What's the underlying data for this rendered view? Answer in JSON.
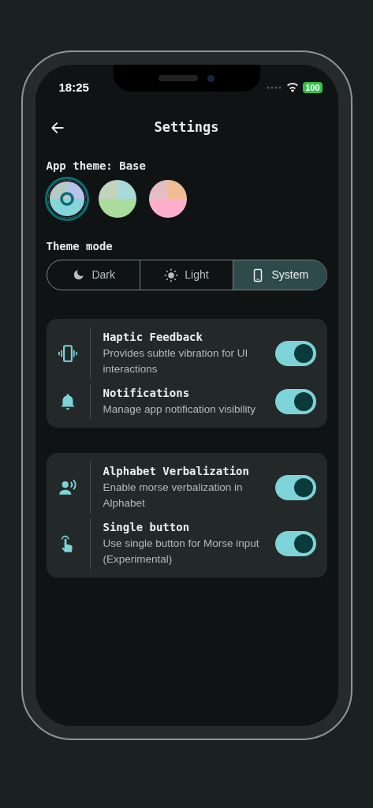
{
  "status_bar": {
    "time": "18:25",
    "battery": "100"
  },
  "header": {
    "title": "Settings"
  },
  "app_theme": {
    "label": "App theme: Base",
    "swatches": [
      {
        "selected": true,
        "parts": [
          {
            "color": "#b7c9c6"
          },
          {
            "color": "#b6c3ea"
          },
          {
            "color": "#86d6d9"
          }
        ]
      },
      {
        "selected": false,
        "parts": [
          {
            "color": "#c2d4bd"
          },
          {
            "color": "#a9d9d8"
          },
          {
            "color": "#a9dc9e"
          }
        ]
      },
      {
        "selected": false,
        "parts": [
          {
            "color": "#e3bdc3"
          },
          {
            "color": "#f0bd94"
          },
          {
            "color": "#ffafcc"
          }
        ]
      }
    ]
  },
  "theme_mode": {
    "label": "Theme mode",
    "options": [
      {
        "kind": "moon",
        "label": "Dark",
        "selected": false
      },
      {
        "kind": "sun",
        "label": "Light",
        "selected": false
      },
      {
        "kind": "phone",
        "label": "System",
        "selected": true
      }
    ]
  },
  "groups": [
    {
      "items": [
        {
          "kind": "vibration",
          "title": "Haptic Feedback",
          "description": "Provides subtle vibration for UI interactions",
          "on": true
        },
        {
          "kind": "bell",
          "title": "Notifications",
          "description": "Manage app notification visibility",
          "on": true
        }
      ]
    },
    {
      "items": [
        {
          "kind": "voice",
          "title": "Alphabet Verbalization",
          "description": "Enable morse verbalization in Alphabet",
          "on": true
        },
        {
          "kind": "touch",
          "title": "Single button",
          "description": "Use single button for Morse input (Experimental)",
          "on": true
        }
      ]
    }
  ]
}
